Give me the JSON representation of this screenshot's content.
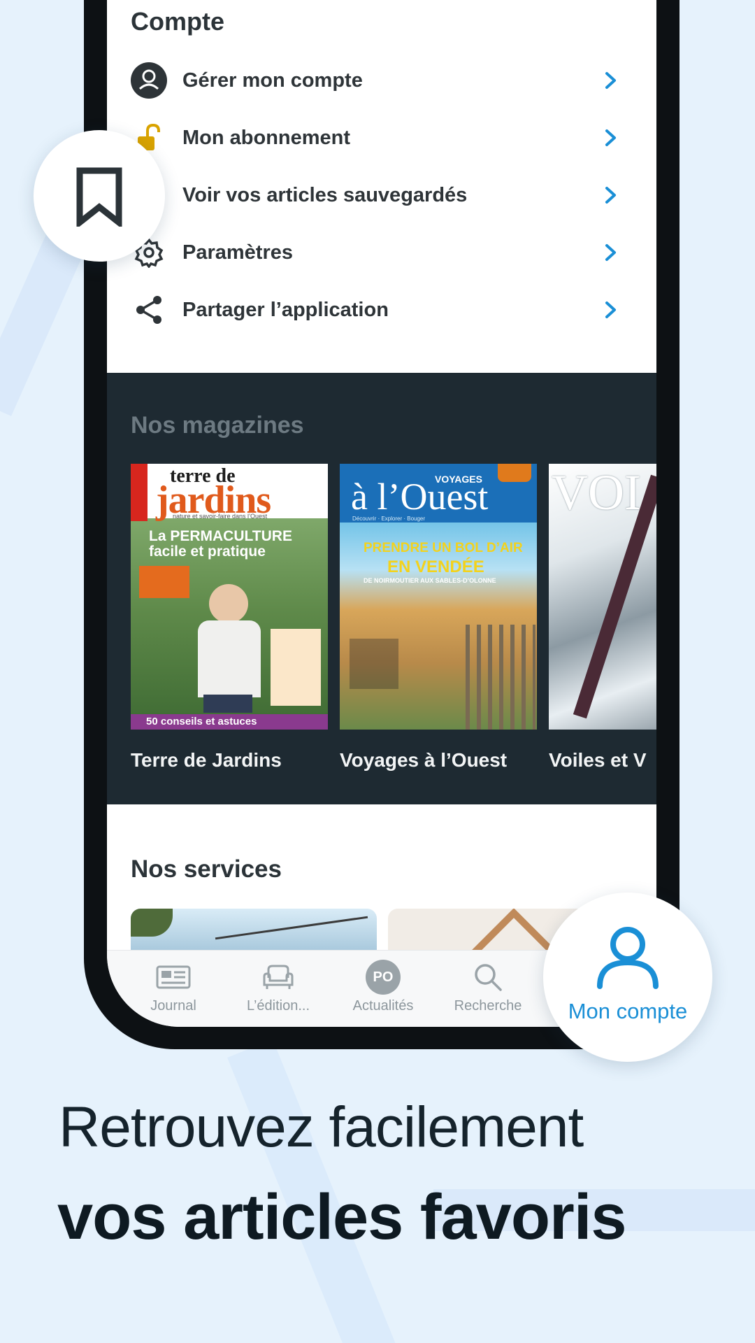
{
  "account": {
    "title": "Compte",
    "items": [
      {
        "label": "Gérer mon compte",
        "icon": "user-circle-icon"
      },
      {
        "label": "Mon abonnement",
        "icon": "padlock-open-icon"
      },
      {
        "label": "Voir vos articles sauvegardés",
        "icon": "bookmark-icon"
      },
      {
        "label": "Paramètres",
        "icon": "gear-icon"
      },
      {
        "label": "Partager l’application",
        "icon": "share-icon"
      }
    ]
  },
  "magazines": {
    "title": "Nos magazines",
    "items": [
      {
        "name": "Terre de Jardins",
        "cover": {
          "masthead_top": "terre de",
          "masthead_main": "jardins",
          "tagline": "nature et savoir-faire dans l’Ouest",
          "headline1": "La PERMACULTURE",
          "headline2": "facile et pratique",
          "footer": "50 conseils et astuces"
        }
      },
      {
        "name": "Voyages à l’Ouest",
        "cover": {
          "masthead_small": "VOYAGES",
          "masthead_main": "à l’Ouest",
          "subline": "Découvrir · Explorer · Bouger",
          "headline1": "PRENDRE UN BOL D’AIR",
          "headline2": "EN VENDÉE",
          "headline3": "DE NOIRMOUTIER AUX SABLES-D’OLONNE"
        }
      },
      {
        "name": "Voiles et V",
        "cover": {
          "masthead_main": "VOI"
        }
      }
    ]
  },
  "services": {
    "title": "Nos services"
  },
  "nav": {
    "items": [
      {
        "label": "Journal",
        "icon": "newspaper-icon"
      },
      {
        "label": "L’édition...",
        "icon": "armchair-icon"
      },
      {
        "label": "Actualités",
        "icon": "po-logo-icon",
        "badge": "PO"
      },
      {
        "label": "Recherche",
        "icon": "search-icon"
      }
    ]
  },
  "bubble_account": {
    "label": "Mon compte",
    "icon": "user-icon"
  },
  "bubble_bookmark": {
    "icon": "bookmark-icon"
  },
  "promo": {
    "line1": "Retrouvez facilement",
    "line2": "vos articles favoris"
  },
  "colors": {
    "accent": "#1a8fd6",
    "background": "#e6f2fc",
    "dark_band": "#1e2a32",
    "lock_yellow": "#d9a300"
  }
}
